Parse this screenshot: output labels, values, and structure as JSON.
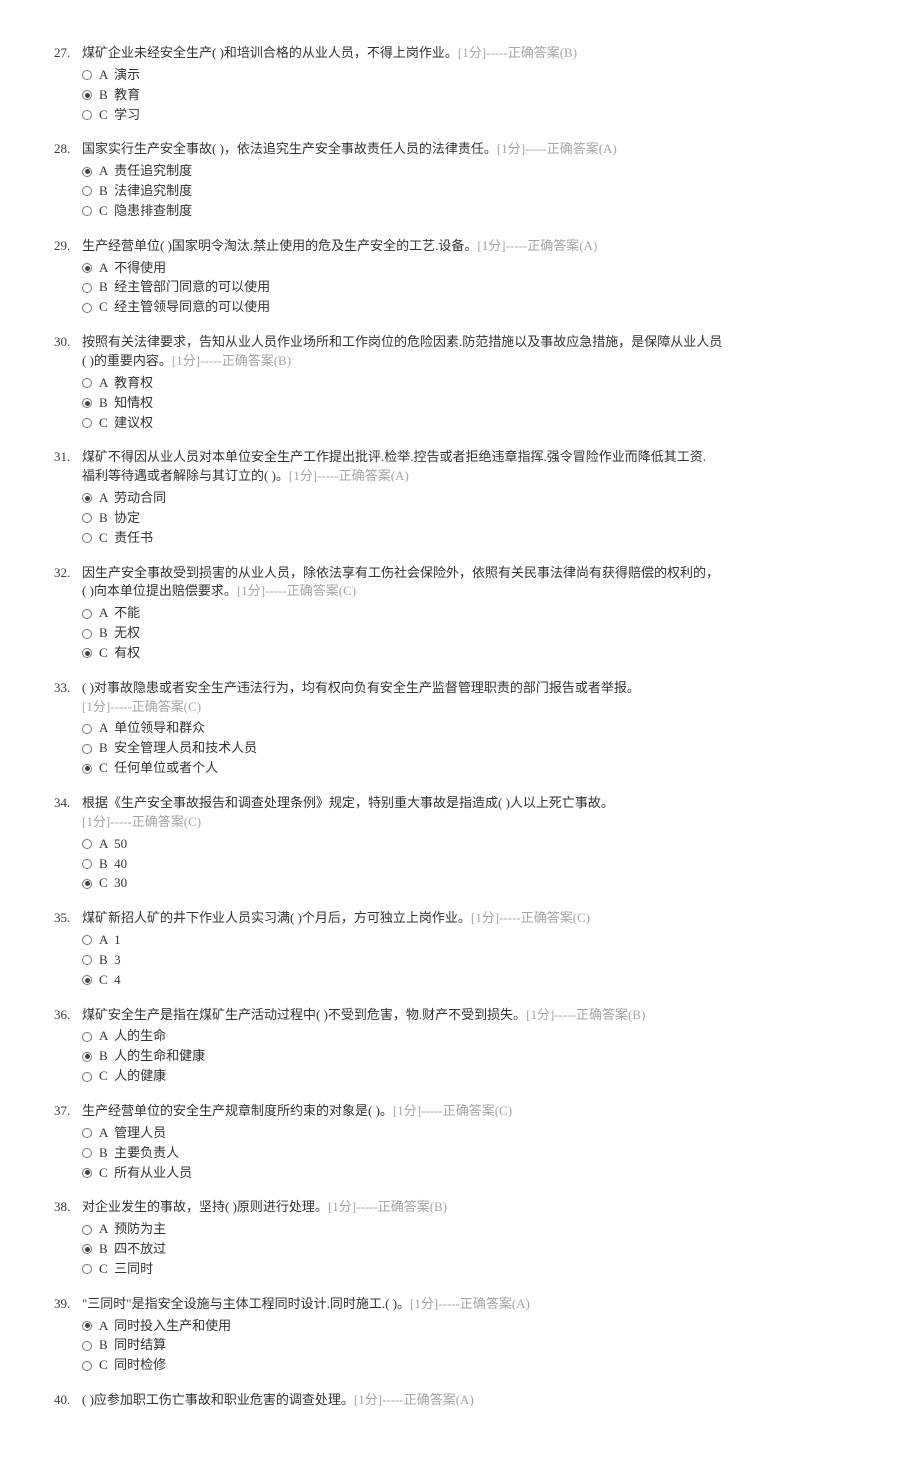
{
  "score_prefix": "[1分]",
  "answer_prefix": "-----正确答案",
  "questions": [
    {
      "num": "27.",
      "text": "煤矿企业未经安全生产(   )和培训合格的从业人员，不得上岗作业。",
      "answer": "B",
      "selected": "B",
      "options": [
        {
          "key": "A",
          "label": "演示"
        },
        {
          "key": "B",
          "label": "教育"
        },
        {
          "key": "C",
          "label": "学习"
        }
      ]
    },
    {
      "num": "28.",
      "text": "国家实行生产安全事故(   )，依法追究生产安全事故责任人员的法律责任。",
      "answer": "A",
      "selected": "A",
      "options": [
        {
          "key": "A",
          "label": "责任追究制度"
        },
        {
          "key": "B",
          "label": "法律追究制度"
        },
        {
          "key": "C",
          "label": "隐患排查制度"
        }
      ]
    },
    {
      "num": "29.",
      "text": "生产经营单位(   )国家明令淘汰.禁止使用的危及生产安全的工艺.设备。",
      "answer": "A",
      "selected": "A",
      "options": [
        {
          "key": "A",
          "label": "不得使用"
        },
        {
          "key": "B",
          "label": "经主管部门同意的可以使用"
        },
        {
          "key": "C",
          "label": "经主管领导同意的可以使用"
        }
      ]
    },
    {
      "num": "30.",
      "text_lines": [
        "按照有关法律要求，告知从业人员作业场所和工作岗位的危险因素.防范措施以及事故应急措施，是保障从业人员",
        "(   )的重要内容。"
      ],
      "answer": "B",
      "selected": "B",
      "score_on_second_line": true,
      "options": [
        {
          "key": "A",
          "label": "教育权"
        },
        {
          "key": "B",
          "label": "知情权"
        },
        {
          "key": "C",
          "label": "建议权"
        }
      ]
    },
    {
      "num": "31.",
      "text_lines": [
        "煤矿不得因从业人员对本单位安全生产工作提出批评.检举.控告或者拒绝违章指挥.强令冒险作业而降低其工资.",
        "福利等待遇或者解除与其订立的(   )。"
      ],
      "answer": "A",
      "selected": "A",
      "score_on_second_line": true,
      "options": [
        {
          "key": "A",
          "label": "劳动合同"
        },
        {
          "key": "B",
          "label": "协定"
        },
        {
          "key": "C",
          "label": "责任书"
        }
      ]
    },
    {
      "num": "32.",
      "text_lines": [
        "因生产安全事故受到损害的从业人员，除依法享有工伤社会保险外，依照有关民事法律尚有获得赔偿的权利的，",
        "(   )向本单位提出赔偿要求。"
      ],
      "answer": "C",
      "selected": "C",
      "score_on_second_line": true,
      "options": [
        {
          "key": "A",
          "label": "不能"
        },
        {
          "key": "B",
          "label": "无权"
        },
        {
          "key": "C",
          "label": "有权"
        }
      ]
    },
    {
      "num": "33.",
      "text_lines": [
        "(   )对事故隐患或者安全生产违法行为，均有权向负有安全生产监督管理职责的部门报告或者举报。"
      ],
      "answer": "C",
      "selected": "C",
      "score_line_alone": true,
      "options": [
        {
          "key": "A",
          "label": "单位领导和群众"
        },
        {
          "key": "B",
          "label": "安全管理人员和技术人员"
        },
        {
          "key": "C",
          "label": "任何单位或者个人"
        }
      ]
    },
    {
      "num": "34.",
      "text_lines": [
        "根据《生产安全事故报告和调查处理条例》规定，特别重大事故是指造成(   )人以上死亡事故。"
      ],
      "answer": "C",
      "selected": "C",
      "score_line_alone": true,
      "options": [
        {
          "key": "A",
          "label": "50"
        },
        {
          "key": "B",
          "label": "40"
        },
        {
          "key": "C",
          "label": "30"
        }
      ]
    },
    {
      "num": "35.",
      "text": "煤矿新招人矿的井下作业人员实习满(   )个月后，方可独立上岗作业。",
      "answer": "C",
      "selected": "C",
      "options": [
        {
          "key": "A",
          "label": "1"
        },
        {
          "key": "B",
          "label": "3"
        },
        {
          "key": "C",
          "label": "4"
        }
      ]
    },
    {
      "num": "36.",
      "text": "煤矿安全生产是指在煤矿生产活动过程中(   )不受到危害，物.财产不受到损失。",
      "answer": "B",
      "selected": "B",
      "options": [
        {
          "key": "A",
          "label": "人的生命"
        },
        {
          "key": "B",
          "label": "人的生命和健康"
        },
        {
          "key": "C",
          "label": "人的健康"
        }
      ]
    },
    {
      "num": "37.",
      "text": "生产经营单位的安全生产规章制度所约束的对象是(   )。",
      "answer": "C",
      "selected": "C",
      "options": [
        {
          "key": "A",
          "label": "管理人员"
        },
        {
          "key": "B",
          "label": "主要负责人"
        },
        {
          "key": "C",
          "label": "所有从业人员"
        }
      ]
    },
    {
      "num": "38.",
      "text": "对企业发生的事故，坚持(   )原则进行处理。",
      "answer": "B",
      "selected": "B",
      "options": [
        {
          "key": "A",
          "label": "预防为主"
        },
        {
          "key": "B",
          "label": "四不放过"
        },
        {
          "key": "C",
          "label": "三同时"
        }
      ]
    },
    {
      "num": "39.",
      "text": "\"三同时\"是指安全设施与主体工程同时设计.同时施工.(   )。",
      "answer": "A",
      "selected": "A",
      "options": [
        {
          "key": "A",
          "label": "同时投入生产和使用"
        },
        {
          "key": "B",
          "label": "同时结算"
        },
        {
          "key": "C",
          "label": "同时检修"
        }
      ]
    },
    {
      "num": "40.",
      "text": "(   )应参加职工伤亡事故和职业危害的调查处理。",
      "answer": "A",
      "no_options": true
    }
  ]
}
